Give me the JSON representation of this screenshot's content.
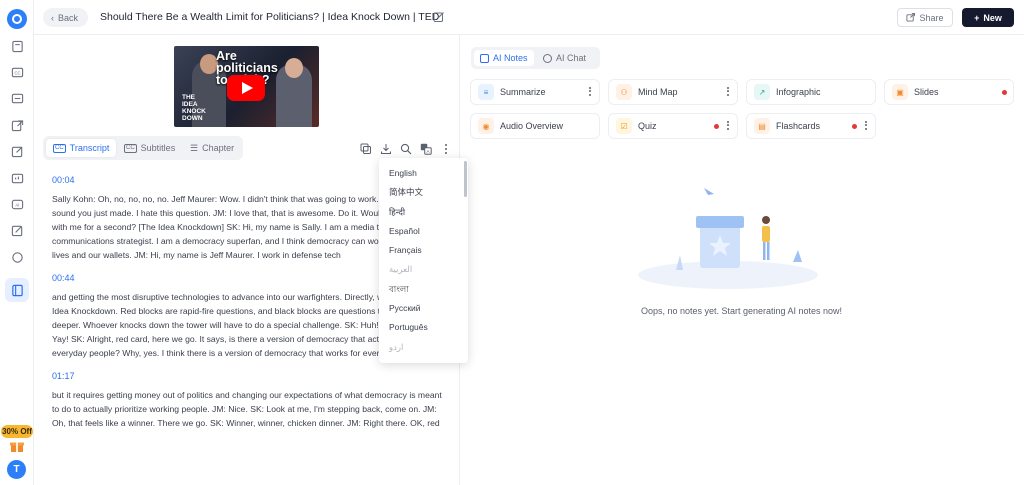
{
  "topbar": {
    "back_label": "Back",
    "title": "Should There Be a Wealth Limit for Politicians? | Idea Knock Down | TED",
    "share_label": "Share",
    "new_label": "New"
  },
  "sidebar": {
    "promo": "30% Off",
    "avatar_initial": "T"
  },
  "video": {
    "overlay_text": "Are politicians too rich?",
    "logo_text": "THE IDEA KNOCK DOWN"
  },
  "left_tabs": [
    {
      "label": "Transcript",
      "active": true
    },
    {
      "label": "Subtitles",
      "active": false
    },
    {
      "label": "Chapter",
      "active": false
    }
  ],
  "transcript": [
    {
      "time": "00:04",
      "text": "Sally Kohn: Oh, no, no, no, no. Jeff Maurer: Wow. I didn't think that was going to work. I liked that sound you just made. I hate this question. JM: I love that, that is awesome. Do it. Would you dance with me for a second? [The Idea Knockdown] SK: Hi, my name is Sally. I am a media trainer and a communications strategist. I am a democracy superfan, and I think democracy can work better for our lives and our wallets. JM: Hi, my name is Jeff Maurer. I work in defense tech"
    },
    {
      "time": "00:44",
      "text": "and getting the most disruptive technologies to advance into our warfighters. Directly, we're playing Idea Knockdown. Red blocks are rapid-fire questions, and black blocks are questions that go a little deeper. Whoever knocks down the tower will have to do a special challenge. SK: Huh! JM: Now on top. Yay! SK: Alright, red card, here we go. It says, is there a version of democracy that actually works for everyday people? Why, yes. I think there is a version of democracy that works for everyday people,"
    },
    {
      "time": "01:17",
      "text": "but it requires getting money out of politics and changing our expectations of what democracy is meant to do to actually prioritize working people. JM: Nice. SK: Look at me, I'm stepping back, come on. JM: Oh, that feels like a winner. There we go. SK: Winner, winner, chicken dinner. JM: Right there. OK, red card. Should there be a wealth limit for those running for office? SK: Oh, interesting. JM: I think we could definitely have a couple beers and talk about this for a very long"
    }
  ],
  "languages": [
    "English",
    "简体中文",
    "हिन्दी",
    "Español",
    "Français",
    "العربية",
    "বাংলা",
    "Русский",
    "Português",
    "اردو"
  ],
  "right_tabs": [
    {
      "label": "AI Notes",
      "active": true
    },
    {
      "label": "AI Chat",
      "active": false
    }
  ],
  "note_cards": [
    {
      "label": "Summarize",
      "icon": "summarize-icon",
      "color": "#e8f3ff",
      "fg": "#2d8cf0"
    },
    {
      "label": "Mind Map",
      "icon": "mind-map-icon",
      "color": "#fff1e6",
      "fg": "#f08a2d"
    },
    {
      "label": "Infographic",
      "icon": "infographic-icon",
      "color": "#e6f7f5",
      "fg": "#1fa88f"
    },
    {
      "label": "Slides",
      "icon": "slides-icon",
      "color": "#fff1e6",
      "fg": "#f08a2d"
    },
    {
      "label": "Audio Overview",
      "icon": "audio-icon",
      "color": "#fff1e6",
      "fg": "#f08a2d"
    },
    {
      "label": "Quiz",
      "icon": "quiz-icon",
      "color": "#fff6e0",
      "fg": "#e0a020"
    },
    {
      "label": "Flashcards",
      "icon": "flashcards-icon",
      "color": "#fff1e6",
      "fg": "#f08a2d"
    }
  ],
  "empty_state": {
    "message": "Oops, no notes yet. Start generating AI notes now!"
  },
  "colors": {
    "accent": "#2d6ff0",
    "dark_button": "#151a2e",
    "notification_dot": "#e5383b",
    "promo": "#f7b733"
  }
}
